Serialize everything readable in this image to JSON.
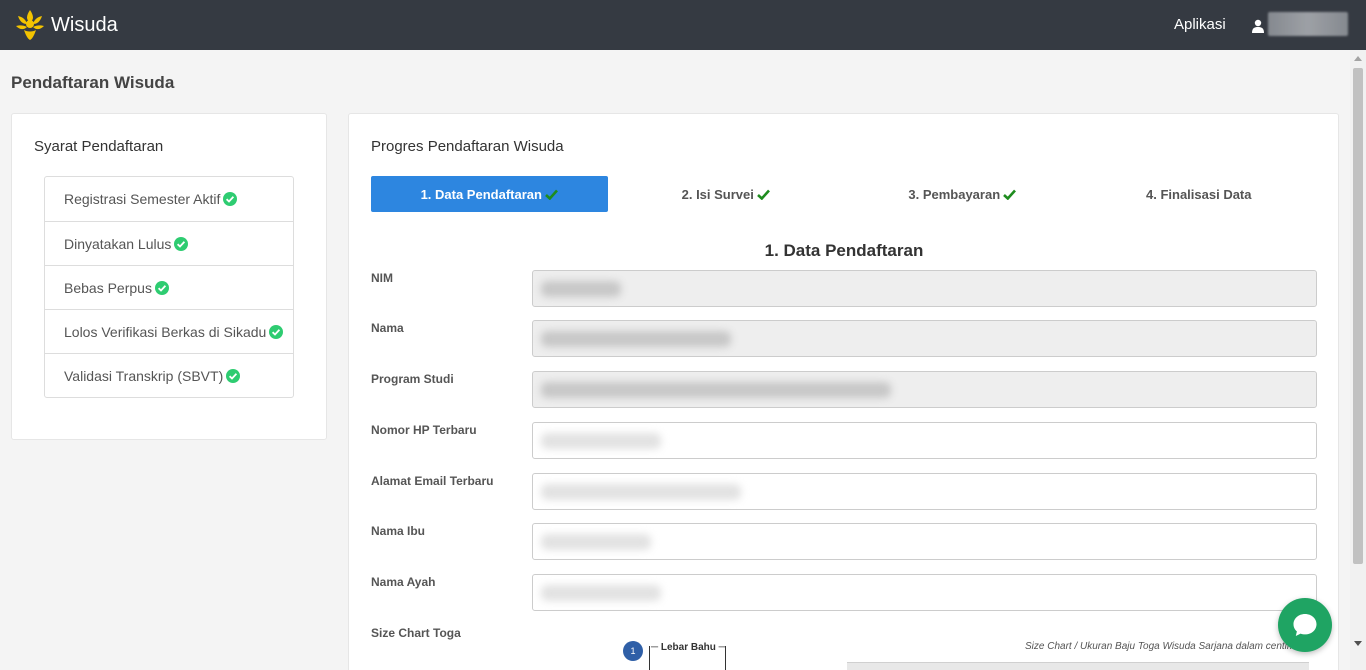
{
  "navbar": {
    "brand": "Wisuda",
    "menu_apps": "Aplikasi"
  },
  "page": {
    "title": "Pendaftaran Wisuda"
  },
  "requirements": {
    "title": "Syarat Pendaftaran",
    "items": [
      {
        "label": "Registrasi Semester Aktif"
      },
      {
        "label": "Dinyatakan Lulus"
      },
      {
        "label": "Bebas Perpus"
      },
      {
        "label": "Lolos Verifikasi Berkas di Sikadu"
      },
      {
        "label": "Validasi Transkrip (SBVT)"
      }
    ]
  },
  "progress": {
    "title": "Progres Pendaftaran Wisuda",
    "steps": [
      {
        "label": "1. Data Pendaftaran",
        "done": true,
        "active": true
      },
      {
        "label": "2. Isi Survei",
        "done": true,
        "active": false
      },
      {
        "label": "3. Pembayaran",
        "done": true,
        "active": false
      },
      {
        "label": "4. Finalisasi Data",
        "done": false,
        "active": false
      }
    ]
  },
  "form": {
    "section_title": "1. Data Pendaftaran",
    "fields": [
      {
        "label": "NIM",
        "readonly": true
      },
      {
        "label": "Nama",
        "readonly": true
      },
      {
        "label": "Program Studi",
        "readonly": true
      },
      {
        "label": "Nomor HP Terbaru",
        "readonly": false
      },
      {
        "label": "Alamat Email Terbaru",
        "readonly": false
      },
      {
        "label": "Nama Ibu",
        "readonly": false
      },
      {
        "label": "Nama Ayah",
        "readonly": false
      }
    ],
    "size_chart_label": "Size Chart Toga",
    "size_chart": {
      "badge": "1",
      "shoulder_label": "Lebar Bahu",
      "caption": "Size Chart / Ukuran Baju Toga Wisuda Sarjana dalam centimeter"
    }
  },
  "colors": {
    "navbar": "#353a42",
    "active_step": "#2d86e0",
    "check_green": "#2ecc71",
    "tick_green": "#1e8c1e",
    "chat_button": "#1fa463"
  }
}
